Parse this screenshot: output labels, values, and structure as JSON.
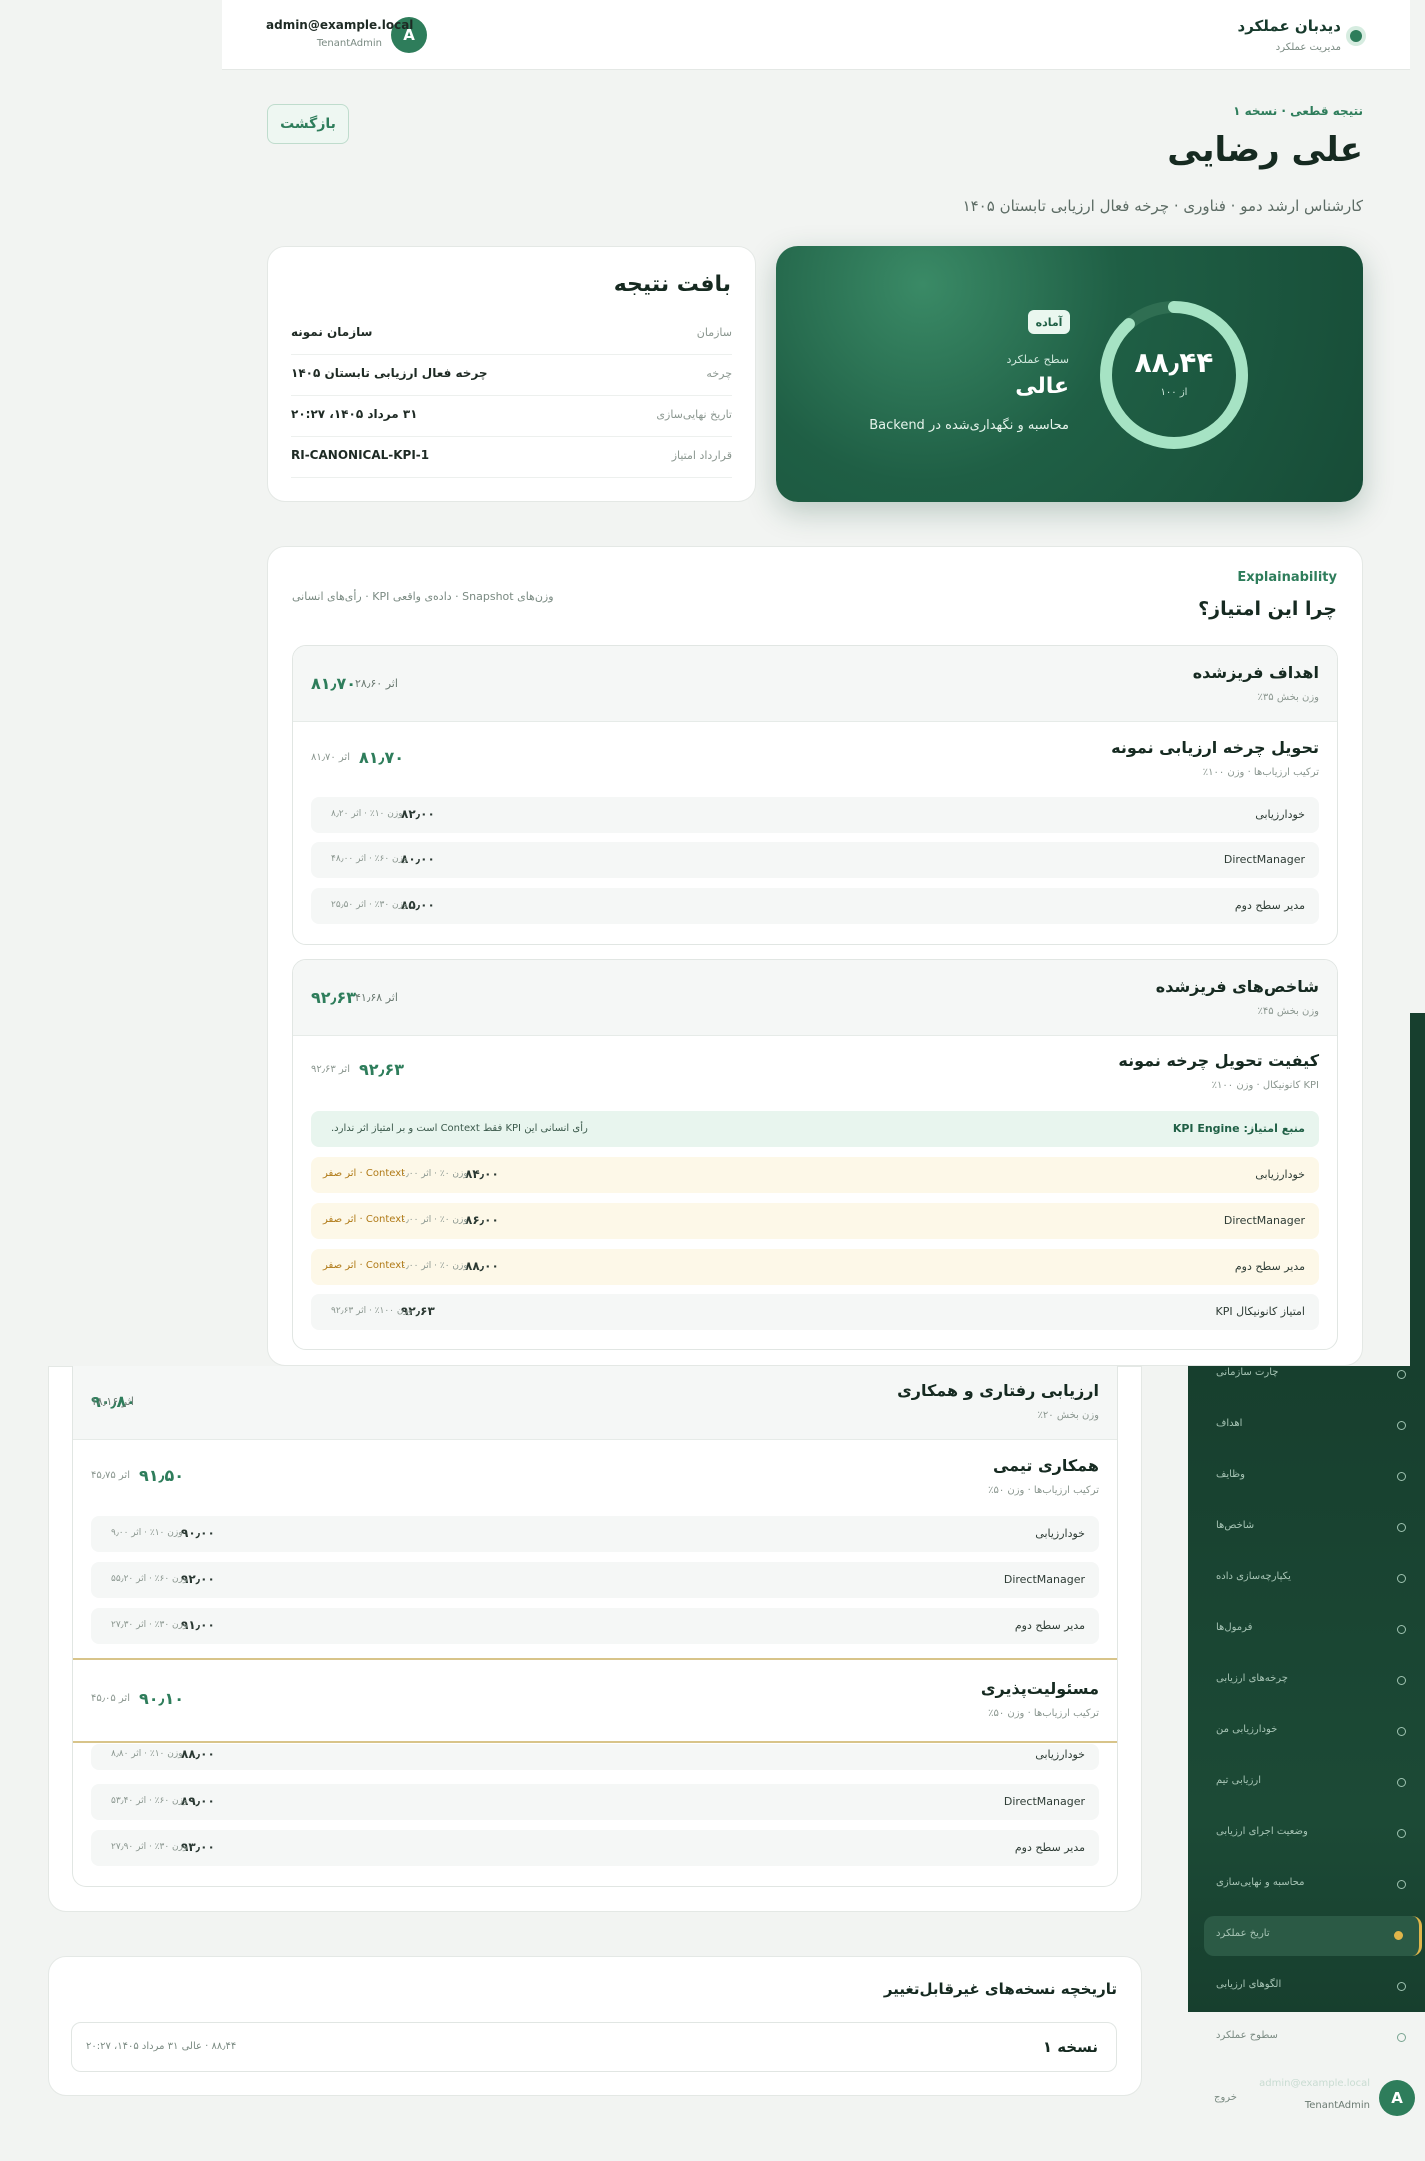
{
  "header": {
    "app_title": "دیدبان عملکرد",
    "app_subtitle": "مدیریت عملکرد",
    "user_email": "admin@example.local",
    "user_role": "TenantAdmin",
    "avatar_letter": "A"
  },
  "page": {
    "back_label": "بازگشت",
    "breadcrumb": "نتیجه قطعی · نسخه ۱",
    "name": "علی رضایی",
    "subtitle": "کارشناس ارشد دمو · فناوری · چرخه فعال ارزیابی تابستان ۱۴۰۵"
  },
  "score": {
    "value": "۸۸٫۴۴",
    "of_label": "از ۱۰۰",
    "fraction": 0.8844,
    "status": "آماده",
    "level_label": "سطح عملکرد",
    "level_value": "عالی",
    "note": "محاسبه و نگهداری‌شده در Backend"
  },
  "context": {
    "title": "بافت نتیجه",
    "rows": [
      {
        "key": "سازمان",
        "value": "سازمان نمونه"
      },
      {
        "key": "چرخه",
        "value": "چرخه فعال ارزیابی تابستان ۱۴۰۵"
      },
      {
        "key": "تاریخ نهایی‌سازی",
        "value": "۳۱ مرداد ۱۴۰۵، ۲۰:۲۷"
      },
      {
        "key": "قرارداد امتیاز",
        "value": "RI-CANONICAL-KPI-1"
      }
    ]
  },
  "explain": {
    "tag": "Explainability",
    "title": "چرا این امتیاز؟",
    "note": "وزن‌های Snapshot · داده‌ی واقعی KPI · رأی‌های انسانی",
    "sections": [
      {
        "title": "اهداف فریزشده",
        "subtitle": "وزن بخش ۳۵٪",
        "score": "۸۱٫۷۰",
        "effect": "اثر ۲۸٫۶۰",
        "items": [
          {
            "title": "تحویل چرخه ارزیابی نمونه",
            "subtitle": "ترکیب ارزیاب‌ها · وزن ۱۰۰٪",
            "score": "۸۱٫۷۰",
            "effect": "اثر ۸۱٫۷۰",
            "raters": [
              {
                "name": "خودارزیابی",
                "score": "۸۲٫۰۰",
                "meta": "وزن ۱۰٪ · اثر ۸٫۲۰"
              },
              {
                "name": "DirectManager",
                "score": "۸۰٫۰۰",
                "meta": "وزن ۶۰٪ · اثر ۴۸٫۰۰"
              },
              {
                "name": "مدیر سطح دوم",
                "score": "۸۵٫۰۰",
                "meta": "وزن ۳۰٪ · اثر ۲۵٫۵۰"
              }
            ]
          }
        ]
      },
      {
        "title": "شاخص‌های فریزشده",
        "subtitle": "وزن بخش ۴۵٪",
        "score": "۹۲٫۶۳",
        "effect": "اثر ۴۱٫۶۸",
        "items": [
          {
            "title": "کیفیت تحویل چرخه نمونه",
            "subtitle": "KPI کانونیکال · وزن ۱۰۰٪",
            "score": "۹۲٫۶۳",
            "effect": "اثر ۹۲٫۶۳",
            "source_label": "منبع امتیاز: KPI Engine",
            "source_note": "رأی انسانی این KPI فقط Context است و بر امتیاز اثر ندارد.",
            "context_raters": [
              {
                "name": "خودارزیابی",
                "score": "۸۴٫۰۰",
                "meta": "وزن ۰٪ · اثر ۰٫۰۰",
                "ctx": "Context · اثر صفر"
              },
              {
                "name": "DirectManager",
                "score": "۸۶٫۰۰",
                "meta": "وزن ۰٪ · اثر ۰٫۰۰",
                "ctx": "Context · اثر صفر"
              },
              {
                "name": "مدیر سطح دوم",
                "score": "۸۸٫۰۰",
                "meta": "وزن ۰٪ · اثر ۰٫۰۰",
                "ctx": "Context · اثر صفر"
              }
            ],
            "kpi_row": {
              "name": "امتیاز کانونیکال KPI",
              "score": "۹۲٫۶۳",
              "meta": "وزن ۱۰۰٪ · اثر ۹۲٫۶۳"
            }
          }
        ]
      },
      {
        "title": "ارزیابی رفتاری و همکاری",
        "subtitle": "وزن بخش ۲۰٪",
        "score": "۹۰٫۸۰",
        "effect": "اثر ۱۸٫۱۶",
        "items": [
          {
            "title": "همکاری تیمی",
            "subtitle": "ترکیب ارزیاب‌ها · وزن ۵۰٪",
            "score": "۹۱٫۵۰",
            "effect": "اثر ۴۵٫۷۵",
            "raters": [
              {
                "name": "خودارزیابی",
                "score": "۹۰٫۰۰",
                "meta": "وزن ۱۰٪ · اثر ۹٫۰۰"
              },
              {
                "name": "DirectManager",
                "score": "۹۲٫۰۰",
                "meta": "وزن ۶۰٪ · اثر ۵۵٫۲۰"
              },
              {
                "name": "مدیر سطح دوم",
                "score": "۹۱٫۰۰",
                "meta": "وزن ۳۰٪ · اثر ۲۷٫۳۰"
              }
            ]
          },
          {
            "title": "مسئولیت‌پذیری",
            "subtitle": "ترکیب ارزیاب‌ها · وزن ۵۰٪",
            "score": "۹۰٫۱۰",
            "effect": "اثر ۴۵٫۰۵",
            "raters": [
              {
                "name": "خودارزیابی",
                "score": "۸۸٫۰۰",
                "meta": "وزن ۱۰٪ · اثر ۸٫۸۰"
              },
              {
                "name": "DirectManager",
                "score": "۸۹٫۰۰",
                "meta": "وزن ۶۰٪ · اثر ۵۳٫۴۰"
              },
              {
                "name": "مدیر سطح دوم",
                "score": "۹۳٫۰۰",
                "meta": "وزن ۳۰٪ · اثر ۲۷٫۹۰"
              }
            ]
          }
        ]
      }
    ]
  },
  "history": {
    "title": "تاریخچه نسخه‌های غیرقابل‌تغییر",
    "version": "نسخه ۱",
    "meta": "۸۸٫۴۴ · عالی   ۳۱ مرداد ۱۴۰۵، ۲۰:۲۷"
  },
  "sidebar": {
    "items": [
      "چارت سازمانی",
      "اهداف",
      "وظایف",
      "شاخص‌ها",
      "یکپارچه‌سازی داده",
      "فرمول‌ها",
      "چرخه‌های ارزیابی",
      "خودارزیابی من",
      "ارزیابی تیم",
      "وضعیت اجرای ارزیابی",
      "محاسبه و نهایی‌سازی",
      "تاریخ عملکرد",
      "الگوهای ارزیابی",
      "سطوح عملکرد"
    ],
    "active_index": 11,
    "user_email": "admin@example.local",
    "user_role": "TenantAdmin",
    "avatar_letter": "A",
    "logout_label": "خروج"
  },
  "colors": {
    "brand": "#2e7d5b",
    "brand_dark": "#174c37",
    "ring_fill": "#a6e3c4",
    "accent_gold": "#e0b54a"
  }
}
